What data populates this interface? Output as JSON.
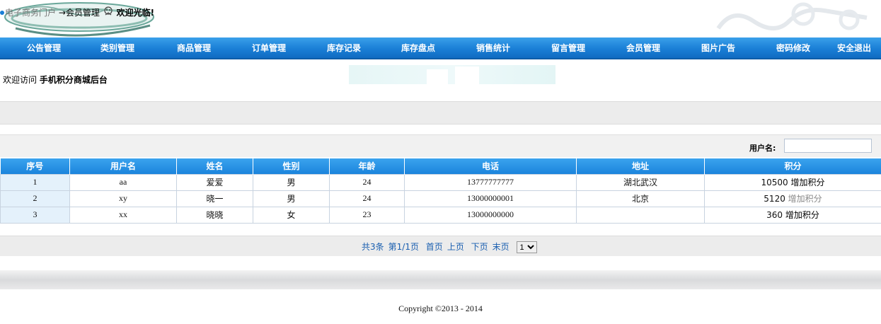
{
  "nav": [
    "公告管理",
    "类别管理",
    "商品管理",
    "订单管理",
    "库存记录",
    "库存盘点",
    "销售统计",
    "留言管理",
    "会员管理",
    "图片广告",
    "密码修改",
    "安全退出"
  ],
  "welcome": {
    "prefix": "欢迎访问",
    "site": "手机积分商城后台"
  },
  "breadcrumb": {
    "portal": "电子商务门户",
    "current": "→会员管理",
    "greeting": "欢迎光临!"
  },
  "search": {
    "label": "用户名:",
    "value": ""
  },
  "table": {
    "headers": [
      "序号",
      "用户名",
      "姓名",
      "性别",
      "年龄",
      "电话",
      "地址",
      "积分"
    ],
    "rows": [
      {
        "idx": "1",
        "username": "aa",
        "name": "爱爱",
        "gender": "男",
        "age": "24",
        "phone": "13777777777",
        "address": "湖北武汉",
        "points": "10500",
        "action": "增加积分"
      },
      {
        "idx": "2",
        "username": "xy",
        "name": "晓一",
        "gender": "男",
        "age": "24",
        "phone": "13000000001",
        "address": "北京",
        "points": "5120",
        "action": "增加积分"
      },
      {
        "idx": "3",
        "username": "xx",
        "name": "晓晓",
        "gender": "女",
        "age": "23",
        "phone": "13000000000",
        "address": "",
        "points": "360",
        "action": "增加积分"
      }
    ]
  },
  "pager": {
    "total": "共3条",
    "page": "第1/1页",
    "first": "首页",
    "prev": "上页",
    "next": "下页",
    "last": "末页",
    "selected": "1"
  },
  "footer": {
    "copyright": "Copyright ©2013 - 2014"
  },
  "colors": {
    "nav": "#1a7fd6",
    "header_row": "#2a94e6"
  }
}
